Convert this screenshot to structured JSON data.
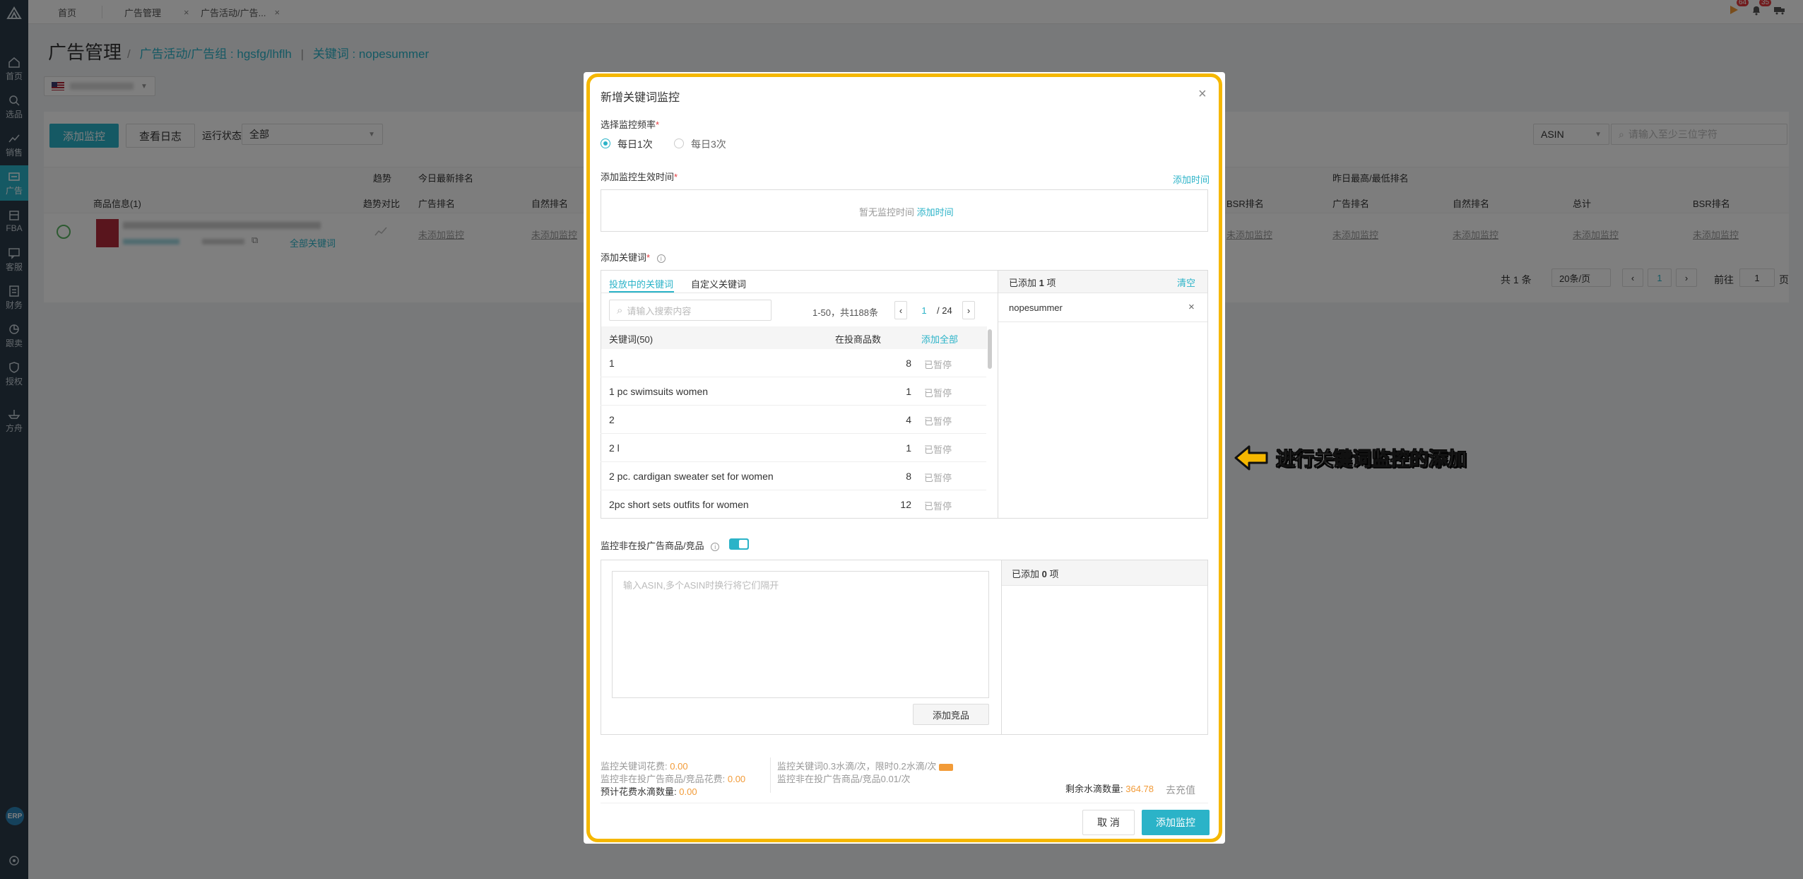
{
  "sidebar": {
    "items": [
      {
        "label": "首页",
        "icon": "home-icon"
      },
      {
        "label": "选品",
        "icon": "search-icon"
      },
      {
        "label": "销售",
        "icon": "chart-line-icon"
      },
      {
        "label": "广告",
        "icon": "ad-icon"
      },
      {
        "label": "FBA",
        "icon": "box-icon"
      },
      {
        "label": "客服",
        "icon": "message-icon"
      },
      {
        "label": "财务",
        "icon": "finance-icon"
      },
      {
        "label": "跟卖",
        "icon": "pie-icon"
      },
      {
        "label": "授权",
        "icon": "shield-icon"
      },
      {
        "label": "方舟",
        "icon": "ark-icon"
      }
    ],
    "erp_label": "ERP"
  },
  "topbar": {
    "tabs": [
      {
        "label": "首页"
      },
      {
        "label": "广告管理"
      },
      {
        "label": "广告活动/广告..."
      }
    ],
    "tab_close": "×",
    "badges": [
      "64",
      "35"
    ]
  },
  "page": {
    "title": "广告管理",
    "breadcrumb_sep": "/",
    "breadcrumb_campaign": "广告活动/广告组 : hgsfg/lhflh",
    "breadcrumb_sep2": "|",
    "breadcrumb_keyword": "关键词 : nopesummer"
  },
  "toolbar": {
    "add_monitor": "添加监控",
    "view_log": "查看日志",
    "status_label": "运行状态",
    "status_value": "全部",
    "asin_select": "ASIN",
    "asin_placeholder": "请输入至少三位字符"
  },
  "table": {
    "group_headers": {
      "trend": "趋势",
      "today": "今日最新排名",
      "yesterday": "昨日最高/最低排名"
    },
    "headers": {
      "product": "商品信息(1)",
      "trend_compare": "趋势对比",
      "ad_rank": "广告排名",
      "natural_rank": "自然排名",
      "bsr_rank": "BSR排名",
      "y_ad_rank": "广告排名",
      "y_natural_rank": "自然排名",
      "total": "总计",
      "y_bsr_rank": "BSR排名"
    },
    "row": {
      "all_keywords": "全部关键词",
      "not_added": "未添加监控"
    }
  },
  "pagination": {
    "total": "共 1 条",
    "page_size": "20条/页",
    "current": "1",
    "goto_label": "前往",
    "goto_value": "1",
    "page_unit": "页"
  },
  "modal": {
    "title": "新增关键词监控",
    "close": "×",
    "freq_label": "选择监控频率",
    "freq_options": [
      "每日1次",
      "每日3次"
    ],
    "time_label": "添加监控生效时间",
    "add_time_link": "添加时间",
    "no_time_text": "暂无监控时间",
    "add_keywords_label": "添加关键词",
    "kw_tabs": [
      "投放中的关键词",
      "自定义关键词"
    ],
    "search_placeholder": "请输入搜索内容",
    "range_text": "1-50，共1188条",
    "page_current": "1",
    "page_total": "/ 24",
    "col_keyword": "关键词(50)",
    "col_count": "在投商品数",
    "add_all": "添加全部",
    "keywords": [
      {
        "kw": "1",
        "count": "8",
        "status": "已暂停"
      },
      {
        "kw": "1 pc swimsuits women",
        "count": "1",
        "status": "已暂停"
      },
      {
        "kw": "2",
        "count": "4",
        "status": "已暂停"
      },
      {
        "kw": "2 l",
        "count": "1",
        "status": "已暂停"
      },
      {
        "kw": "2 pc. cardigan sweater set for women",
        "count": "8",
        "status": "已暂停"
      },
      {
        "kw": "2pc short sets outfits for women",
        "count": "12",
        "status": "已暂停"
      }
    ],
    "added_prefix": "已添加",
    "added_count": "1",
    "added_suffix": "项",
    "clear": "清空",
    "added_items": [
      "nopesummer"
    ],
    "remove": "×",
    "non_ad_label": "监控非在投广告商品/竞品",
    "asin_textarea_placeholder": "输入ASIN,多个ASIN时换行将它们隔开",
    "add_product": "添加竞品",
    "added2_count": "0",
    "fee_kw_label": "监控关键词花费:",
    "fee_kw_value": "0.00",
    "fee_non_ad_label": "监控非在投广告商品/竞品花费:",
    "fee_non_ad_value": "0.00",
    "estimate_label": "预计花费水滴数量:",
    "estimate_value": "0.00",
    "rule_kw": "监控关键词0.3水滴/次，限时0.2水滴/次",
    "rule_non_ad": "监控非在投广告商品/竞品0.01/次",
    "remaining_label": "剩余水滴数量:",
    "remaining_value": "364.78",
    "recharge": "去充值",
    "cancel": "取 消",
    "submit": "添加监控"
  },
  "callout": {
    "text": "进行关键词监控的添加"
  },
  "colors": {
    "accent": "#2bb3c8",
    "highlight_border": "#f5b700",
    "orange": "#f29b38",
    "sidebar_bg": "#2a3a48"
  }
}
